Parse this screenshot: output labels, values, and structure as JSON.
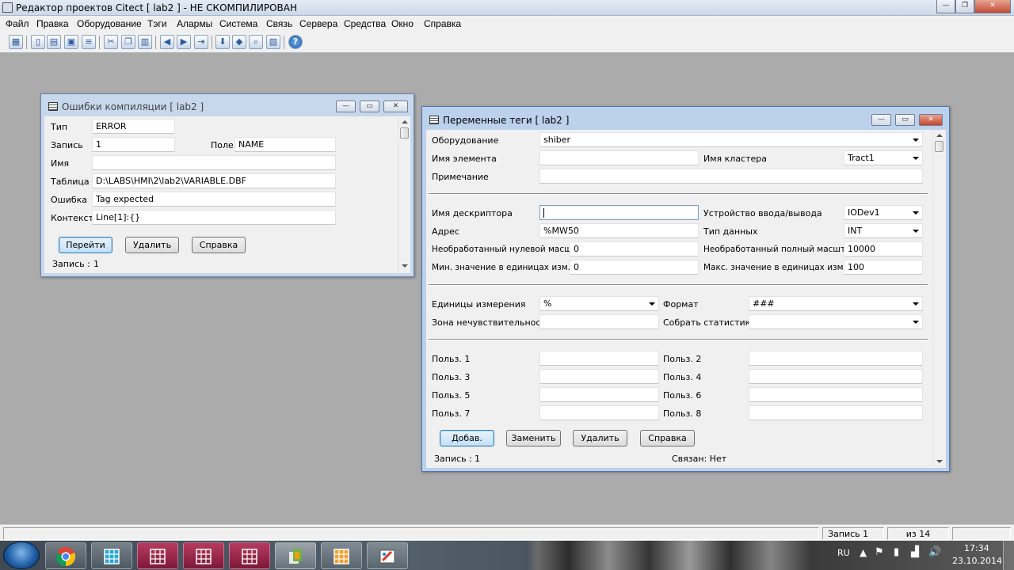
{
  "app": {
    "title": "Редактор проектов Citect [ lab2 ] - НЕ СКОМПИЛИРОВАН"
  },
  "menu": [
    "Файл",
    "Правка",
    "Оборудование",
    "Тэги",
    "Алармы",
    "Система",
    "Связь",
    "Сервера",
    "Средства",
    "Окно",
    "Справка"
  ],
  "toolbar_icons": [
    "project-icon",
    "new-icon",
    "open-icon",
    "cut-icon",
    "copy-icon",
    "paste-icon",
    "back-icon",
    "forward-icon",
    "goto-icon",
    "pack-icon",
    "compile-icon",
    "run-icon",
    "find-icon",
    "help-icon"
  ],
  "errors_win": {
    "title": "Ошибки компиляции [ lab2 ]",
    "labels": {
      "type": "Тип",
      "record": "Запись",
      "field": "Поле",
      "name": "Имя",
      "table": "Таблица",
      "error": "Ошибка",
      "context": "Контекст"
    },
    "values": {
      "type": "ERROR",
      "record": "1",
      "field": "NAME",
      "name": "",
      "table": "D:\\LABS\\HMI\\2\\lab2\\VARIABLE.DBF",
      "error": "Tag expected",
      "context": "Line[1]:{}"
    },
    "buttons": {
      "goto": "Перейти",
      "delete": "Удалить",
      "help": "Справка"
    },
    "status_label": "Запись :",
    "status_value": "1"
  },
  "tags_win": {
    "title": "Переменные теги [ lab2 ]",
    "labels": {
      "equipment": "Оборудование",
      "element": "Имя элемента",
      "cluster": "Имя кластера",
      "comment": "Примечание",
      "descriptor": "Имя дескриптора",
      "io_device": "Устройство ввода/вывода",
      "address": "Адрес",
      "data_type": "Тип данных",
      "raw_zero": "Необработанный нулевой масштаб",
      "raw_full": "Необработанный полный масштаб",
      "eng_min": "Мин. значение в единицах изм.",
      "eng_max": "Макс. значение в единицах изм.",
      "eng_units": "Единицы измерения",
      "format": "Формат",
      "deadband": "Зона нечувствительности",
      "stats": "Собрать статистику",
      "user1": "Польз. 1",
      "user2": "Польз. 2",
      "user3": "Польз. 3",
      "user4": "Польз. 4",
      "user5": "Польз. 5",
      "user6": "Польз. 6",
      "user7": "Польз. 7",
      "user8": "Польз. 8"
    },
    "values": {
      "equipment": "shiber",
      "element": "",
      "cluster": "Tract1",
      "comment": "",
      "descriptor": "",
      "io_device": "IODev1",
      "address": "%MW50",
      "data_type": "INT",
      "raw_zero": "0",
      "raw_full": "10000",
      "eng_min": "0",
      "eng_max": "100",
      "eng_units": "%",
      "format": "###",
      "deadband": "",
      "stats": "",
      "user1": "",
      "user2": "",
      "user3": "",
      "user4": "",
      "user5": "",
      "user6": "",
      "user7": "",
      "user8": ""
    },
    "buttons": {
      "add": "Добав.",
      "replace": "Заменить",
      "delete": "Удалить",
      "help": "Справка"
    },
    "status_label": "Запись :",
    "status_value": "1",
    "linked": "Связан: Нет"
  },
  "statusbar": {
    "record": "Запись 1",
    "of": "из 14"
  },
  "taskbar": {
    "apps": [
      "chrome-icon",
      "citect-icon",
      "citect-icon",
      "citect-icon",
      "citect-icon",
      "office-icon",
      "citect-icon",
      "paint-icon"
    ],
    "lang": "RU",
    "time": "17:34",
    "date": "23.10.2014"
  }
}
